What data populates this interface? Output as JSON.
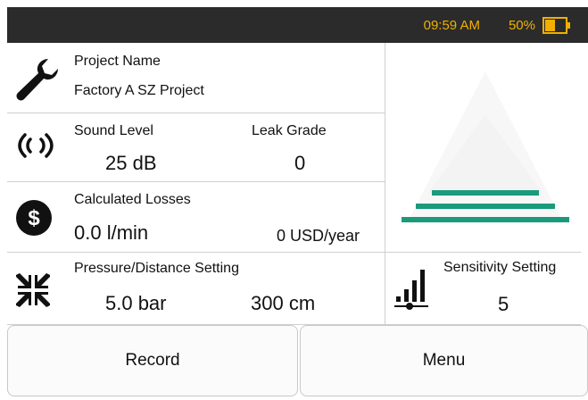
{
  "status": {
    "time": "09:59 AM",
    "battery_percent": "50%",
    "battery_level": 0.5
  },
  "project": {
    "label": "Project Name",
    "value": "Factory A SZ Project"
  },
  "sound": {
    "label": "Sound Level",
    "value": "25 dB",
    "leak_grade_label": "Leak Grade",
    "leak_grade_value": "0"
  },
  "losses": {
    "label": "Calculated Losses",
    "flow": "0.0 l/min",
    "cost": "0 USD/year"
  },
  "pressure": {
    "label": "Pressure/Distance Setting",
    "pressure_value": "5.0 bar",
    "distance_value": "300 cm"
  },
  "sensitivity": {
    "label": "Sensitivity Setting",
    "value": "5"
  },
  "buttons": {
    "record": "Record",
    "menu": "Menu"
  },
  "colors": {
    "accent": "#f0b000",
    "status_bg": "#2b2b2b",
    "graph_green": "#1a9a7c"
  },
  "icons": {
    "project": "wrench-icon",
    "sound": "sound-wave-icon",
    "losses": "dollar-icon",
    "pressure": "compress-arrows-icon",
    "sensitivity": "signal-bars-icon"
  }
}
